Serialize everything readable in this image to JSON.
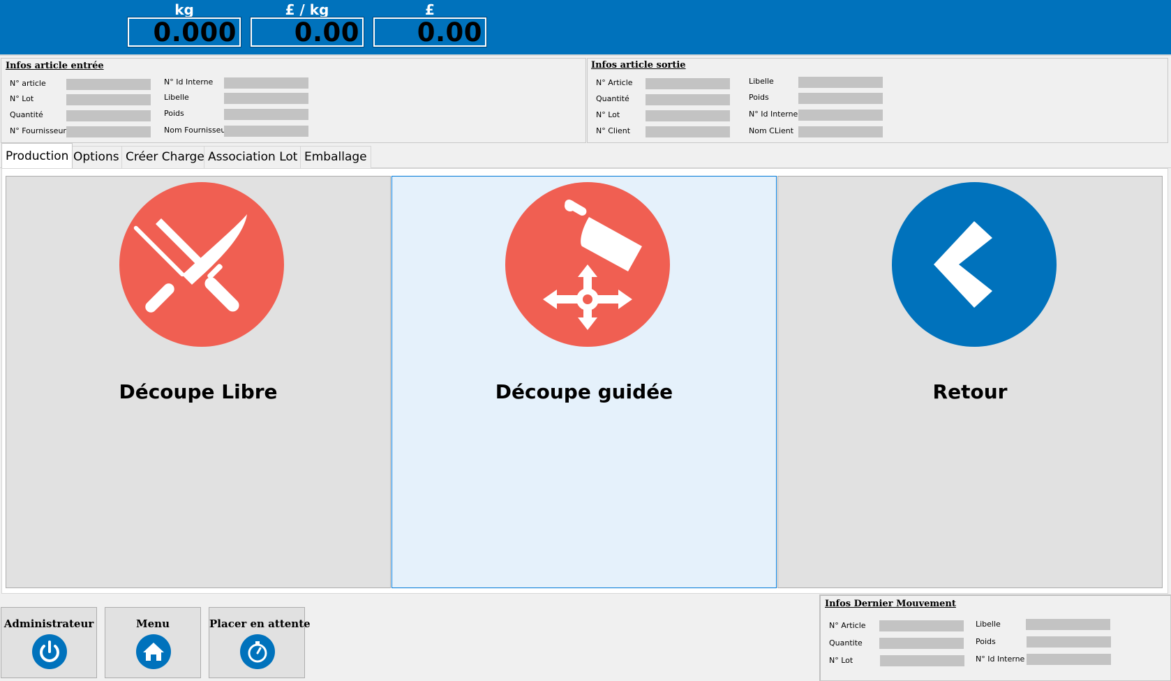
{
  "readouts": [
    {
      "unit": "kg",
      "value": "0.000"
    },
    {
      "unit": "£ / kg",
      "value": "0.00"
    },
    {
      "unit": "£",
      "value": "0.00"
    }
  ],
  "entree": {
    "title": "Infos article entrée",
    "col1": [
      "N° article",
      "N° Lot",
      "Quantité",
      "N° Fournisseur"
    ],
    "col2": [
      "N° Id Interne",
      "Libelle",
      "Poids",
      "Nom Fournisseur"
    ]
  },
  "sortie": {
    "title": "Infos article sortie",
    "col1": [
      "N° Article",
      "Quantité",
      "N° Lot",
      "N° Client"
    ],
    "col2": [
      "Libelle",
      "Poids",
      "N° Id Interne",
      "Nom CLient"
    ]
  },
  "tabs": [
    "Production",
    "Options",
    "Créer Charge",
    "Association Lot",
    "Emballage"
  ],
  "actions": {
    "libre": "Découpe Libre",
    "guidee": "Découpe guidée",
    "retour": "Retour"
  },
  "bottom_buttons": {
    "admin": "Administrateur",
    "menu": "Menu",
    "attente": "Placer en attente"
  },
  "dernier": {
    "title": "Infos Dernier Mouvement",
    "col1": [
      "N° Article",
      "Quantite",
      "N° Lot"
    ],
    "col2": [
      "Libelle",
      "Poids",
      "N° Id Interne"
    ]
  },
  "colors": {
    "brand_blue": "#0072bc",
    "action_red": "#f05f52",
    "hover_bg": "#e5f1fb"
  }
}
